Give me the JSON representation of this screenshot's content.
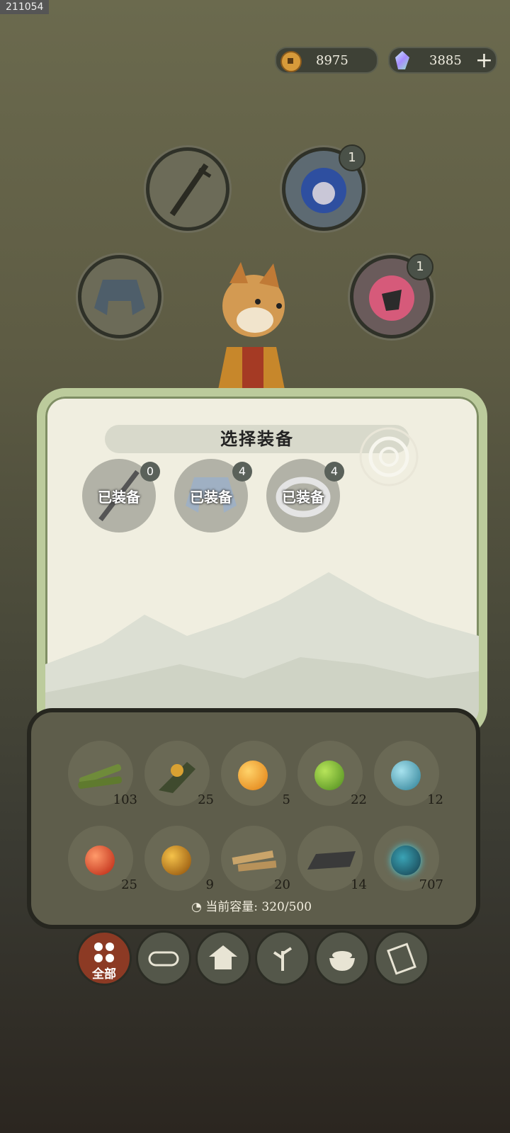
{
  "top_tag": "211054",
  "currency": {
    "coins": "8975",
    "gems": "3885",
    "coin_icon": "copper-coin-icon",
    "gem_icon": "crystal-gem-icon"
  },
  "slots": [
    {
      "name": "weapon-slot",
      "icon": "sword-icon",
      "badge": ""
    },
    {
      "name": "spirit-slot-blue",
      "icon": "blue-spirit-icon",
      "badge": "1"
    },
    {
      "name": "armor-slot",
      "icon": "robe-icon",
      "badge": ""
    },
    {
      "name": "spirit-slot-red",
      "icon": "red-spirit-icon",
      "badge": "1"
    }
  ],
  "panel": {
    "title": "选择装备",
    "options": [
      {
        "label": "已装备",
        "badge": "0",
        "icon": "sword-icon"
      },
      {
        "label": "已装备",
        "badge": "4",
        "icon": "robe-icon"
      },
      {
        "label": "已装备",
        "badge": "4",
        "icon": "ring-icon"
      }
    ]
  },
  "inventory": {
    "items": [
      {
        "icon": "bamboo-icon",
        "count": "103"
      },
      {
        "icon": "herb-icon",
        "count": "25"
      },
      {
        "icon": "orange-orb-icon",
        "count": "5"
      },
      {
        "icon": "green-orb-icon",
        "count": "22"
      },
      {
        "icon": "blue-orb-icon",
        "count": "12"
      },
      {
        "icon": "red-orb-icon",
        "count": "25"
      },
      {
        "icon": "amber-orb-icon",
        "count": "9"
      },
      {
        "icon": "wood-plank-icon",
        "count": "20"
      },
      {
        "icon": "iron-ingot-icon",
        "count": "14"
      },
      {
        "icon": "spirit-orb-icon",
        "count": "707"
      }
    ],
    "capacity_label": "当前容量:",
    "capacity_value": "320/500"
  },
  "tabs": [
    {
      "label": "全部",
      "icon": "grid-icon",
      "active": true
    },
    {
      "label": "",
      "icon": "log-icon"
    },
    {
      "label": "",
      "icon": "house-icon"
    },
    {
      "label": "",
      "icon": "sprout-icon"
    },
    {
      "label": "",
      "icon": "rice-bowl-icon"
    },
    {
      "label": "",
      "icon": "scroll-icon"
    }
  ],
  "colors": {
    "panel_border": "#bccb9c",
    "active_tab": "#8c3a24"
  }
}
